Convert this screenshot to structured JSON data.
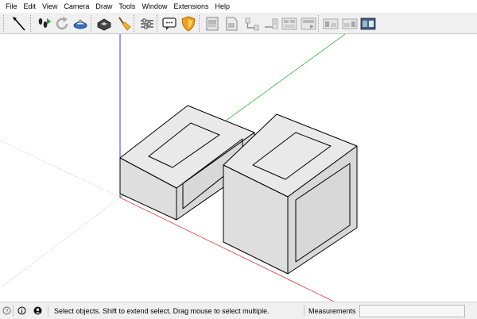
{
  "menu": {
    "items": [
      {
        "label": "File"
      },
      {
        "label": "Edit"
      },
      {
        "label": "View"
      },
      {
        "label": "Camera"
      },
      {
        "label": "Draw"
      },
      {
        "label": "Tools"
      },
      {
        "label": "Window"
      },
      {
        "label": "Extensions"
      },
      {
        "label": "Help"
      }
    ]
  },
  "toolbar": {
    "buttons": [
      {
        "icon": "select-arrow-icon"
      },
      {
        "icon": "footprints-icon"
      },
      {
        "icon": "reload-icon"
      },
      {
        "icon": "warehouse-icon"
      },
      {
        "icon": "extension-warehouse-icon"
      },
      {
        "icon": "sandbox-brush-icon"
      },
      {
        "icon": "sliders-icon"
      },
      {
        "icon": "speech-bubble-icon"
      },
      {
        "icon": "shield-icon"
      },
      {
        "icon": "layout-scrapbook-icon"
      },
      {
        "icon": "layout-document-icon"
      },
      {
        "icon": "send-to-layout-icon"
      },
      {
        "icon": "style-builder-icon"
      },
      {
        "icon": "export-icon"
      },
      {
        "icon": "scene-previous-icon"
      },
      {
        "icon": "scene-next-icon"
      },
      {
        "icon": "scene-dark-icon"
      }
    ]
  },
  "colors": {
    "axis_red": "#e03c3c",
    "axis_green": "#3cb03c",
    "axis_blue": "#3c3ce0",
    "face_light": "#e9e9e9",
    "face_mid": "#dedede",
    "face_dark": "#d8d8d8",
    "edge": "#000000"
  },
  "status": {
    "hint": "Select objects. Shift to extend select. Drag mouse to select multiple.",
    "measurements_label": "Measurements",
    "measurements_value": ""
  }
}
